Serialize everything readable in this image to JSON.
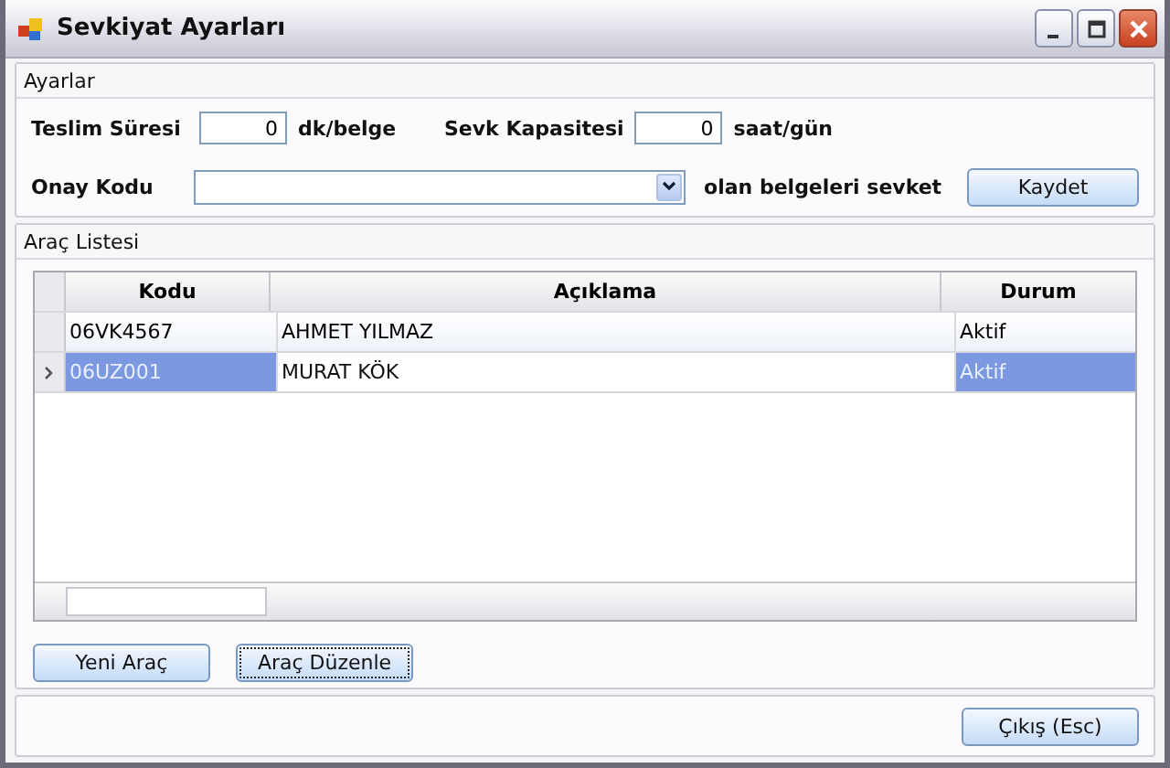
{
  "window": {
    "title": "Sevkiyat Ayarları"
  },
  "settings": {
    "title": "Ayarlar",
    "delivery_time": {
      "label": "Teslim Süresi",
      "value": "0",
      "unit": "dk/belge"
    },
    "capacity": {
      "label": "Sevk Kapasitesi",
      "value": "0",
      "unit": "saat/gün"
    },
    "approval_code": {
      "label": "Onay Kodu",
      "suffix": "olan belgeleri sevket"
    },
    "save_button": "Kaydet"
  },
  "vehicles": {
    "title": "Araç Listesi",
    "columns": [
      "Kodu",
      "Açıklama",
      "Durum"
    ],
    "rows": [
      {
        "cells": [
          "06VK4567",
          "AHMET YILMAZ",
          "Aktif"
        ],
        "selected": false
      },
      {
        "cells": [
          "06UZ001",
          "MURAT KÖK",
          "Aktif"
        ],
        "selected": true
      }
    ],
    "buttons": [
      {
        "label": "Yeni Araç",
        "focused": false
      },
      {
        "label": "Araç Düzenle",
        "focused": true
      }
    ]
  },
  "exit_button": "Çıkış (Esc)"
}
